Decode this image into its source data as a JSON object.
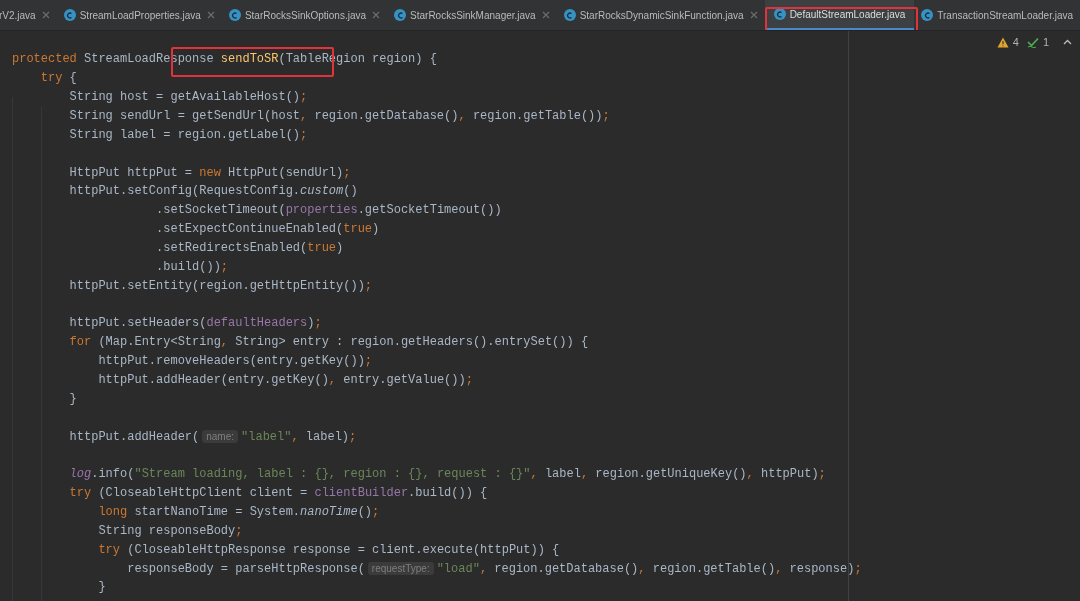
{
  "tabs": [
    {
      "kind": "clipped",
      "label": "rV2.java",
      "selected": false,
      "highlighted": false
    },
    {
      "kind": "file",
      "label": "StreamLoadProperties.java",
      "selected": false,
      "highlighted": false
    },
    {
      "kind": "file",
      "label": "StarRocksSinkOptions.java",
      "selected": false,
      "highlighted": false
    },
    {
      "kind": "file",
      "label": "StarRocksSinkManager.java",
      "selected": false,
      "highlighted": false
    },
    {
      "kind": "file",
      "label": "StarRocksDynamicSinkFunction.java",
      "selected": false,
      "highlighted": false
    },
    {
      "kind": "file",
      "label": "DefaultStreamLoader.java",
      "selected": true,
      "highlighted": true
    },
    {
      "kind": "file",
      "label": "TransactionStreamLoader.java",
      "selected": false,
      "highlighted": false
    }
  ],
  "inspections": {
    "warnings": "4",
    "weak_warnings": "1"
  },
  "code_lines": [
    {
      "kind": "code",
      "highlighted": true,
      "segments": [
        {
          "kind": "keyword",
          "text": "protected"
        },
        {
          "kind": "plain",
          "text": " StreamLoadResponse "
        },
        {
          "kind": "method",
          "text": "sendToSR"
        },
        {
          "kind": "plain",
          "text": "(TableRegion region) {"
        }
      ]
    },
    {
      "kind": "code",
      "segments": [
        {
          "kind": "keyword",
          "text": "    try"
        },
        {
          "kind": "plain",
          "text": " {"
        }
      ]
    },
    {
      "kind": "code",
      "segments": [
        {
          "kind": "plain",
          "text": "        String host = getAvailableHost()"
        },
        {
          "kind": "keyword",
          "text": ";"
        }
      ]
    },
    {
      "kind": "code",
      "segments": [
        {
          "kind": "plain",
          "text": "        String sendUrl = getSendUrl(host"
        },
        {
          "kind": "keyword",
          "text": ","
        },
        {
          "kind": "plain",
          "text": " region.getDatabase()"
        },
        {
          "kind": "keyword",
          "text": ","
        },
        {
          "kind": "plain",
          "text": " region.getTable())"
        },
        {
          "kind": "keyword",
          "text": ";"
        }
      ]
    },
    {
      "kind": "code",
      "segments": [
        {
          "kind": "plain",
          "text": "        String label = region.getLabel()"
        },
        {
          "kind": "keyword",
          "text": ";"
        }
      ]
    },
    {
      "kind": "blank"
    },
    {
      "kind": "code",
      "segments": [
        {
          "kind": "plain",
          "text": "        HttpPut httpPut = "
        },
        {
          "kind": "keyword",
          "text": "new"
        },
        {
          "kind": "plain",
          "text": " HttpPut(sendUrl)"
        },
        {
          "kind": "keyword",
          "text": ";"
        }
      ]
    },
    {
      "kind": "code",
      "segments": [
        {
          "kind": "plain",
          "text": "        httpPut.setConfig(RequestConfig."
        },
        {
          "kind": "static",
          "text": "custom"
        },
        {
          "kind": "plain",
          "text": "()"
        }
      ]
    },
    {
      "kind": "code",
      "segments": [
        {
          "kind": "plain",
          "text": "                    .setSocketTimeout("
        },
        {
          "kind": "field",
          "text": "properties"
        },
        {
          "kind": "plain",
          "text": ".getSocketTimeout())"
        }
      ]
    },
    {
      "kind": "code",
      "segments": [
        {
          "kind": "plain",
          "text": "                    .setExpectContinueEnabled("
        },
        {
          "kind": "keyword",
          "text": "true"
        },
        {
          "kind": "plain",
          "text": ")"
        }
      ]
    },
    {
      "kind": "code",
      "segments": [
        {
          "kind": "plain",
          "text": "                    .setRedirectsEnabled("
        },
        {
          "kind": "keyword",
          "text": "true"
        },
        {
          "kind": "plain",
          "text": ")"
        }
      ]
    },
    {
      "kind": "code",
      "segments": [
        {
          "kind": "plain",
          "text": "                    .build())"
        },
        {
          "kind": "keyword",
          "text": ";"
        }
      ]
    },
    {
      "kind": "code",
      "segments": [
        {
          "kind": "plain",
          "text": "        httpPut.setEntity(region.getHttpEntity())"
        },
        {
          "kind": "keyword",
          "text": ";"
        }
      ]
    },
    {
      "kind": "blank"
    },
    {
      "kind": "code",
      "segments": [
        {
          "kind": "plain",
          "text": "        httpPut.setHeaders("
        },
        {
          "kind": "field",
          "text": "defaultHeaders"
        },
        {
          "kind": "plain",
          "text": ")"
        },
        {
          "kind": "keyword",
          "text": ";"
        }
      ]
    },
    {
      "kind": "code",
      "segments": [
        {
          "kind": "keyword",
          "text": "        for"
        },
        {
          "kind": "plain",
          "text": " (Map.Entry<String"
        },
        {
          "kind": "keyword",
          "text": ","
        },
        {
          "kind": "plain",
          "text": " String> entry : region.getHeaders().entrySet()) {"
        }
      ]
    },
    {
      "kind": "code",
      "segments": [
        {
          "kind": "plain",
          "text": "            httpPut.removeHeaders(entry.getKey())"
        },
        {
          "kind": "keyword",
          "text": ";"
        }
      ]
    },
    {
      "kind": "code",
      "segments": [
        {
          "kind": "plain",
          "text": "            httpPut.addHeader(entry.getKey()"
        },
        {
          "kind": "keyword",
          "text": ","
        },
        {
          "kind": "plain",
          "text": " entry.getValue())"
        },
        {
          "kind": "keyword",
          "text": ";"
        }
      ]
    },
    {
      "kind": "code",
      "segments": [
        {
          "kind": "plain",
          "text": "        }"
        }
      ]
    },
    {
      "kind": "blank"
    },
    {
      "kind": "code",
      "segments": [
        {
          "kind": "plain",
          "text": "        httpPut.addHeader("
        },
        {
          "kind": "hint",
          "text": "name:"
        },
        {
          "kind": "string",
          "text": "\"label\""
        },
        {
          "kind": "keyword",
          "text": ","
        },
        {
          "kind": "plain",
          "text": " label)"
        },
        {
          "kind": "keyword",
          "text": ";"
        }
      ]
    },
    {
      "kind": "blank"
    },
    {
      "kind": "code",
      "segments": [
        {
          "kind": "static_field",
          "text": "        log"
        },
        {
          "kind": "plain",
          "text": ".info("
        },
        {
          "kind": "string",
          "text": "\"Stream loading, label : {}, region : {}, request : {}\""
        },
        {
          "kind": "keyword",
          "text": ","
        },
        {
          "kind": "plain",
          "text": " label"
        },
        {
          "kind": "keyword",
          "text": ","
        },
        {
          "kind": "plain",
          "text": " region.getUniqueKey()"
        },
        {
          "kind": "keyword",
          "text": ","
        },
        {
          "kind": "plain",
          "text": " httpPut)"
        },
        {
          "kind": "keyword",
          "text": ";"
        }
      ]
    },
    {
      "kind": "code",
      "segments": [
        {
          "kind": "keyword",
          "text": "        try"
        },
        {
          "kind": "plain",
          "text": " (CloseableHttpClient client = "
        },
        {
          "kind": "field",
          "text": "clientBuilder"
        },
        {
          "kind": "plain",
          "text": ".build()) {"
        }
      ]
    },
    {
      "kind": "code",
      "segments": [
        {
          "kind": "keyword",
          "text": "            long"
        },
        {
          "kind": "plain",
          "text": " startNanoTime = System."
        },
        {
          "kind": "static",
          "text": "nanoTime"
        },
        {
          "kind": "plain",
          "text": "()"
        },
        {
          "kind": "keyword",
          "text": ";"
        }
      ]
    },
    {
      "kind": "code",
      "segments": [
        {
          "kind": "plain",
          "text": "            String responseBody"
        },
        {
          "kind": "keyword",
          "text": ";"
        }
      ]
    },
    {
      "kind": "code",
      "segments": [
        {
          "kind": "keyword",
          "text": "            try"
        },
        {
          "kind": "plain",
          "text": " (CloseableHttpResponse response = client.execute(httpPut)) {"
        }
      ]
    },
    {
      "kind": "code",
      "segments": [
        {
          "kind": "plain",
          "text": "                responseBody = parseHttpResponse("
        },
        {
          "kind": "hint",
          "text": "requestType:"
        },
        {
          "kind": "string",
          "text": "\"load\""
        },
        {
          "kind": "keyword",
          "text": ","
        },
        {
          "kind": "plain",
          "text": " region.getDatabase()"
        },
        {
          "kind": "keyword",
          "text": ","
        },
        {
          "kind": "plain",
          "text": " region.getTable()"
        },
        {
          "kind": "keyword",
          "text": ","
        },
        {
          "kind": "plain",
          "text": " response)"
        },
        {
          "kind": "keyword",
          "text": ";"
        }
      ]
    },
    {
      "kind": "code",
      "segments": [
        {
          "kind": "plain",
          "text": "            }"
        }
      ]
    }
  ]
}
